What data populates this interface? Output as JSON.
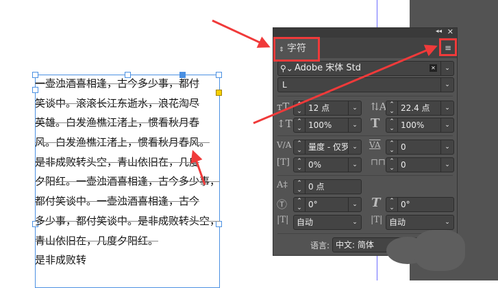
{
  "document": {
    "lines": [
      "一壶浊酒喜相逢，古今多少事，都付",
      "笑谈中。滚滚长江东逝水，浪花淘尽",
      "英雄。白发渔樵江渚上，惯看秋月春",
      "风。白发渔樵江渚上，惯看秋月春风。",
      "是非成败转头空，青山依旧在，几度",
      "夕阳红。一壶浊酒喜相逢，古今多少事，",
      "都付笑谈中。一壶浊酒喜相逢，古今",
      "多少事，都付笑谈中。是非成败转头空，",
      "青山依旧在，几度夕阳红。",
      "是非成败转"
    ]
  },
  "panel": {
    "tab": "字符",
    "font_family": "Adobe 宋体 Std",
    "font_style": "L",
    "font_size": "12 点",
    "leading": "22.4 点",
    "vertical_scale": "100%",
    "horizontal_scale": "100%",
    "kerning": "量度 - 仅罗",
    "tracking": "0",
    "tsume": "0%",
    "aki": "0",
    "baseline_shift": "0 点",
    "rotation": "0°",
    "skew": "0°",
    "mojisoroe_left": "自动",
    "mojisoroe_right": "自动",
    "language_label": "语言:",
    "language": "中文: 简体"
  },
  "colors": {
    "highlight": "#f03a3a",
    "selection": "#4a90e2"
  }
}
